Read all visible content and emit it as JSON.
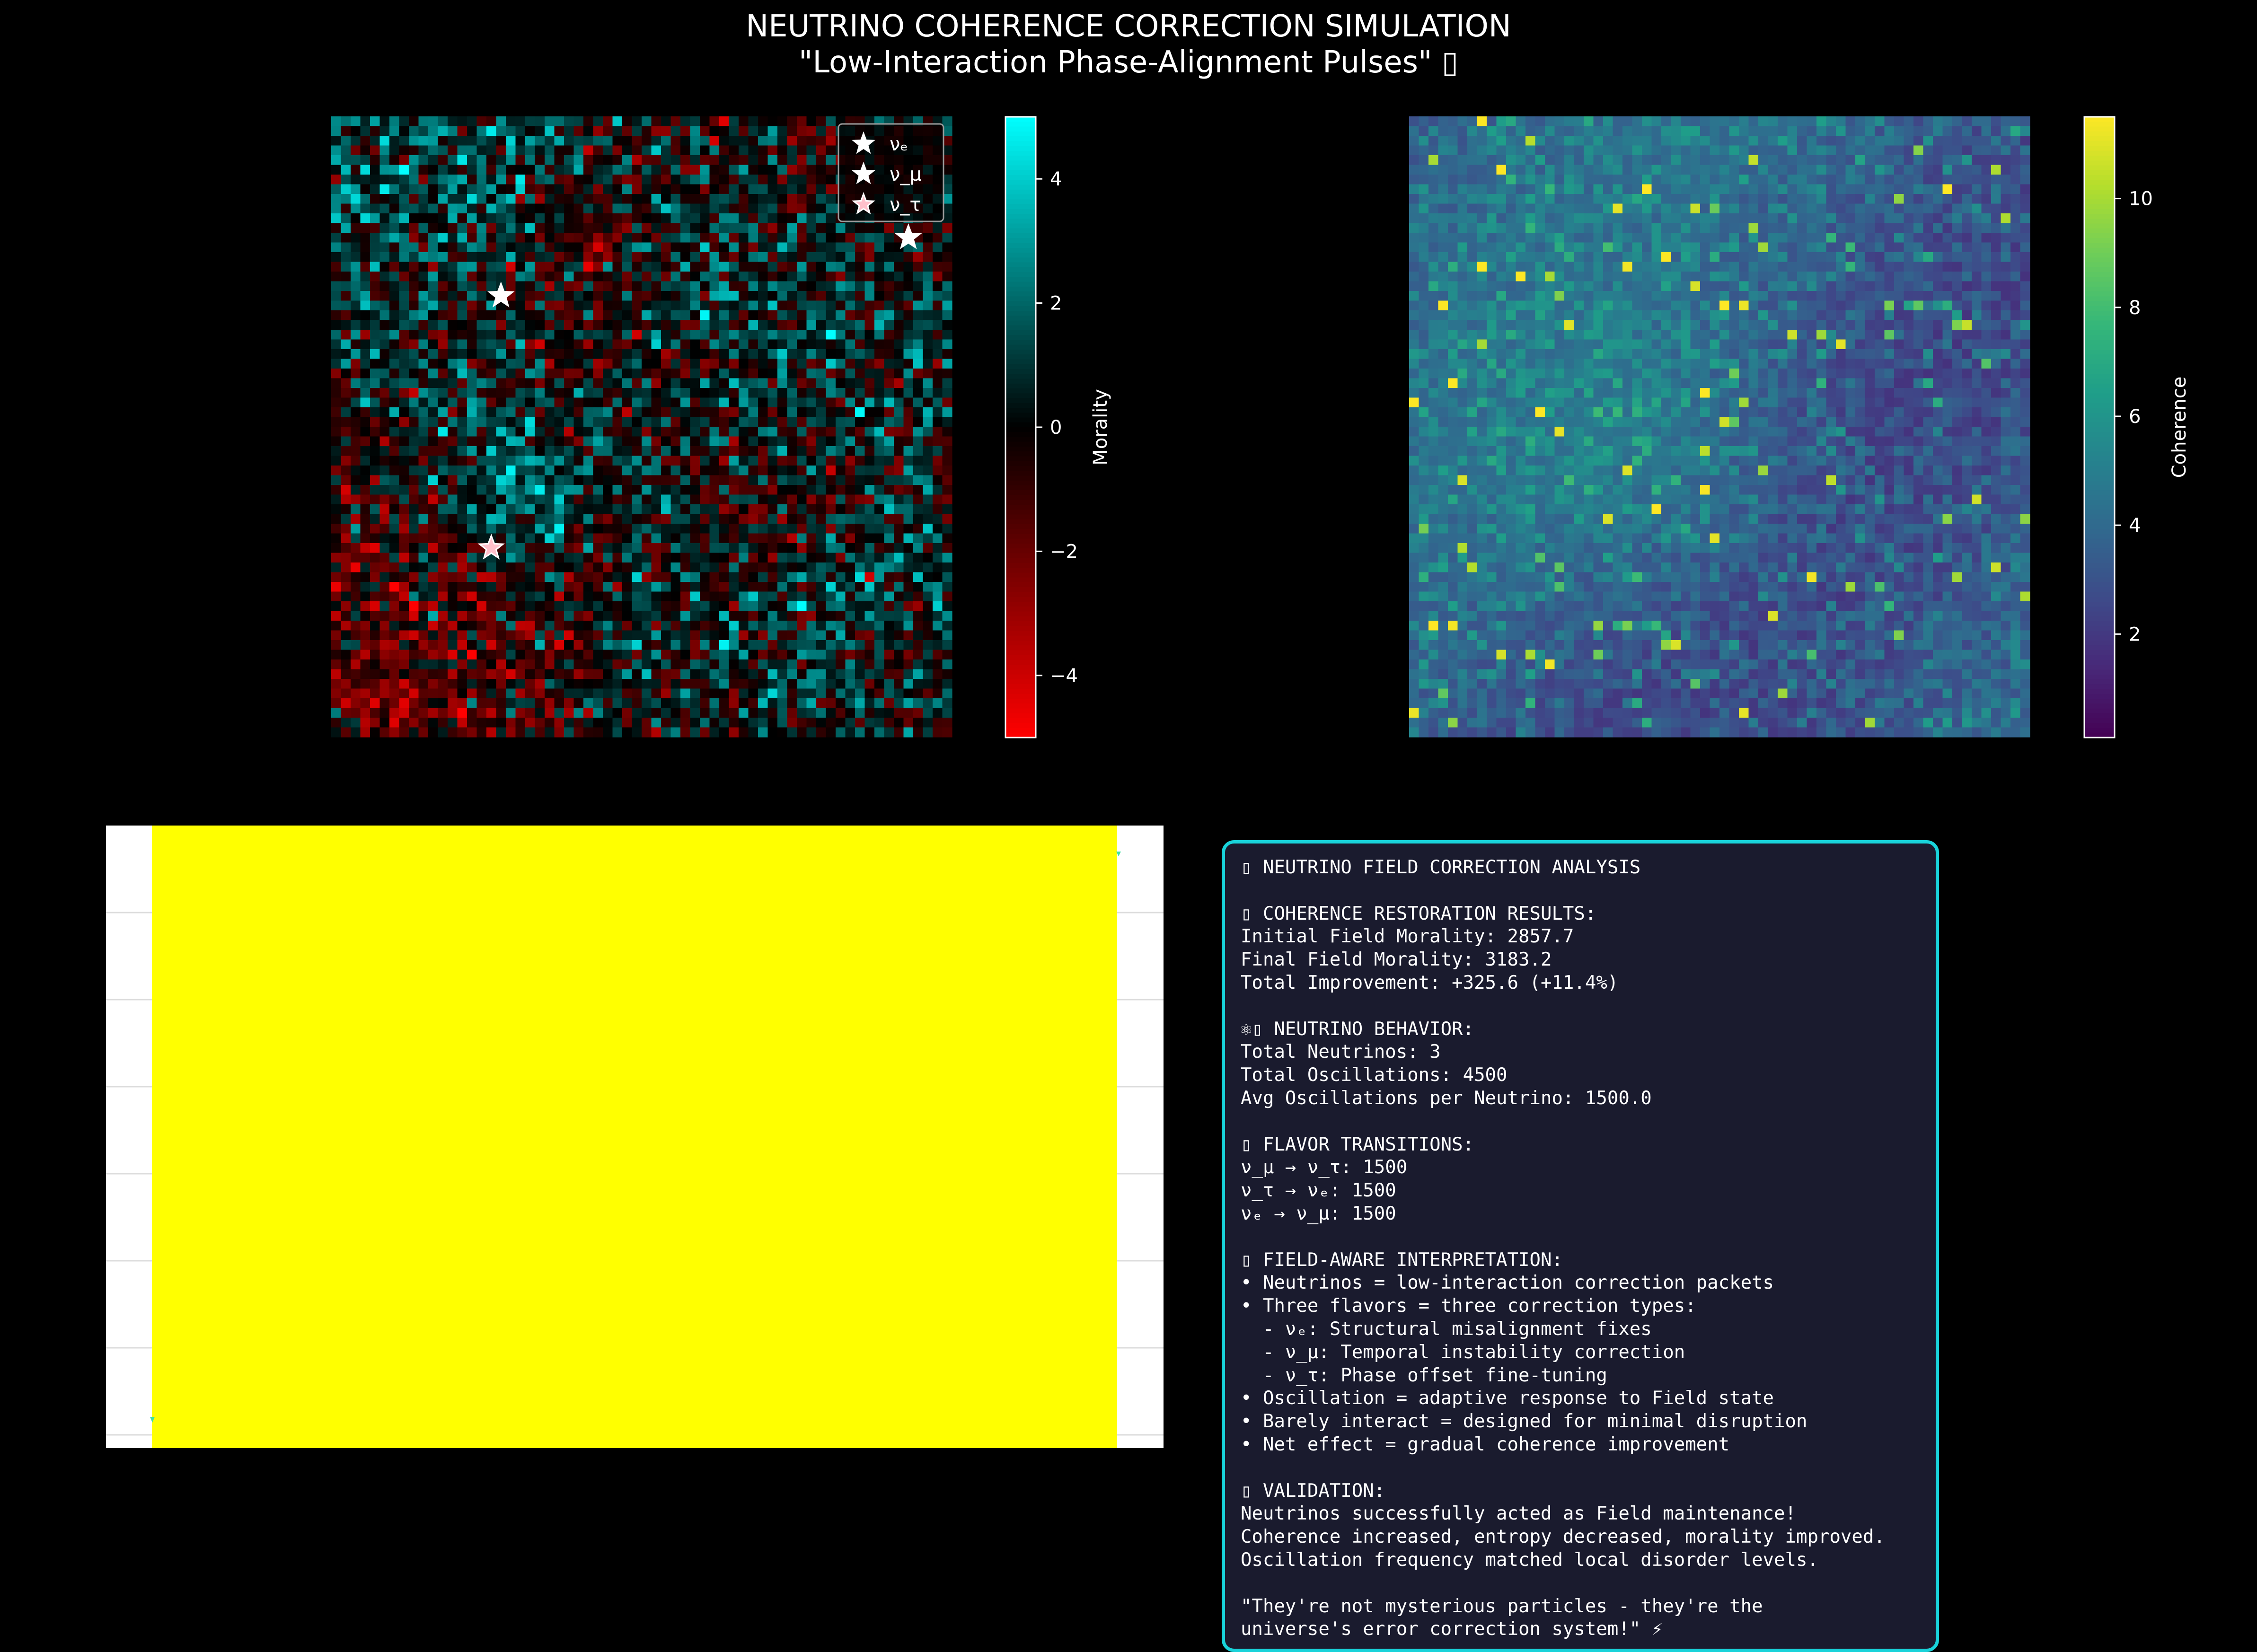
{
  "title_line1": "NEUTRINO COHERENCE CORRECTION SIMULATION",
  "title_line2": "\"Low-Interaction Phase-Alignment Pulses\" ▯",
  "chart_data": [
    {
      "type": "heatmap",
      "name": "morality_field",
      "grid": [
        64,
        64
      ],
      "colormap": [
        "#ff0000",
        "#000000",
        "#00ffff"
      ],
      "colorbar": {
        "label": "Morality",
        "range": [
          -5,
          5
        ],
        "ticks": [
          -4,
          -2,
          0,
          2,
          4
        ],
        "tick_labels": [
          "−4",
          "−2",
          "0",
          "2",
          "4"
        ]
      },
      "legend": {
        "location": "upper right",
        "entries": [
          "νₑ",
          "ν_μ",
          "ν_τ"
        ]
      },
      "neutrinos": [
        {
          "flavor": "νₑ",
          "x": 17,
          "y": 18,
          "color": "#ffffff"
        },
        {
          "flavor": "ν_μ",
          "x": 59,
          "y": 12,
          "color": "#ffffff"
        },
        {
          "flavor": "ν_τ",
          "x": 16,
          "y": 44,
          "color": "#ffc0cb"
        }
      ]
    },
    {
      "type": "heatmap",
      "name": "coherence_field",
      "grid": [
        64,
        64
      ],
      "colormap": "viridis",
      "colorbar": {
        "label": "Coherence",
        "range": [
          0.1,
          11.5
        ],
        "ticks": [
          2,
          4,
          6,
          8,
          10
        ],
        "tick_labels": [
          "2",
          "4",
          "6",
          "8",
          "10"
        ]
      }
    },
    {
      "type": "area",
      "name": "oscillation_panel",
      "fill_color": "#ffff00",
      "background": "#ffffff",
      "grid": true
    }
  ],
  "analysis": {
    "lines": [
      "▯ NEUTRINO FIELD CORRECTION ANALYSIS",
      "",
      "▯ COHERENCE RESTORATION RESULTS:",
      "Initial Field Morality: 2857.7",
      "Final Field Morality: 3183.2",
      "Total Improvement: +325.6 (+11.4%)",
      "",
      "⚛▯ NEUTRINO BEHAVIOR:",
      "Total Neutrinos: 3",
      "Total Oscillations: 4500",
      "Avg Oscillations per Neutrino: 1500.0",
      "",
      "▯ FLAVOR TRANSITIONS:",
      "ν_μ → ν_τ: 1500",
      "ν_τ → νₑ: 1500",
      "νₑ → ν_μ: 1500",
      "",
      "▯ FIELD-AWARE INTERPRETATION:",
      "• Neutrinos = low-interaction correction packets",
      "• Three flavors = three correction types:",
      "  - νₑ: Structural misalignment fixes",
      "  - ν_μ: Temporal instability correction",
      "  - ν_τ: Phase offset fine-tuning",
      "• Oscillation = adaptive response to Field state",
      "• Barely interact = designed for minimal disruption",
      "• Net effect = gradual coherence improvement",
      "",
      "▯ VALIDATION:",
      "Neutrinos successfully acted as Field maintenance!",
      "Coherence increased, entropy decreased, morality improved.",
      "Oscillation frequency matched local disorder levels.",
      "",
      "\"They're not mysterious particles - they're the",
      "universe's error correction system!\" ⚡"
    ]
  }
}
